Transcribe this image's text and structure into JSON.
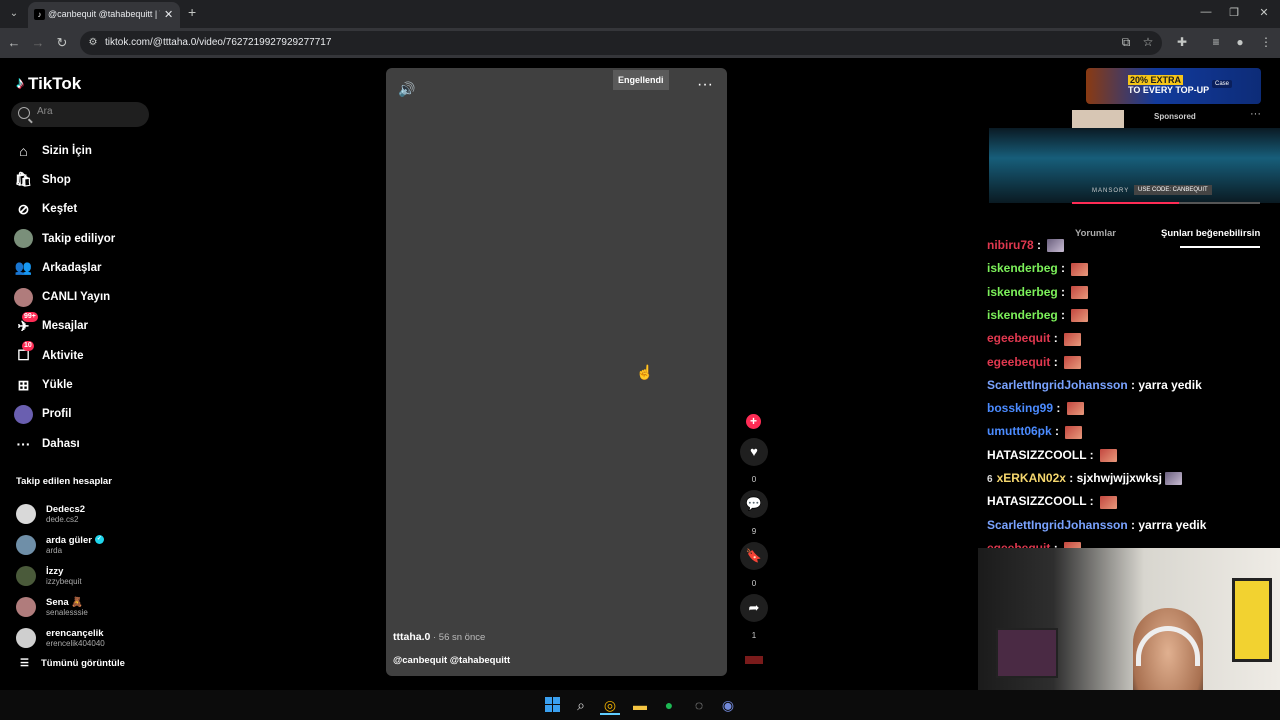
{
  "browser": {
    "tab_title": "@canbequit @tahabequitt | TikTok",
    "url": "tiktok.com/@tttaha.0/video/7627219927929277717",
    "new_tab_glyph": "+",
    "close_glyph": "✕"
  },
  "tiktok": {
    "logo_text": "TikTok",
    "search_placeholder": "Ara",
    "nav": [
      {
        "label": "Sizin İçin",
        "icon": "home-icon"
      },
      {
        "label": "Shop",
        "icon": "shop-icon"
      },
      {
        "label": "Keşfet",
        "icon": "compass-icon"
      },
      {
        "label": "Takip ediliyor",
        "icon": "following-avatar-icon"
      },
      {
        "label": "Arkadaşlar",
        "icon": "friends-icon"
      },
      {
        "label": "CANLI Yayın",
        "icon": "live-avatar-icon"
      },
      {
        "label": "Mesajlar",
        "icon": "messages-icon",
        "badge": "99+"
      },
      {
        "label": "Aktivite",
        "icon": "activity-icon",
        "badge": "10"
      },
      {
        "label": "Yükle",
        "icon": "upload-icon"
      },
      {
        "label": "Profil",
        "icon": "profile-avatar-icon"
      },
      {
        "label": "Dahası",
        "icon": "more-icon"
      }
    ],
    "following_title": "Takip edilen hesaplar",
    "following": [
      {
        "name": "Dedecs2",
        "handle": "dede.cs2",
        "avatar_color": "#d9d9d9"
      },
      {
        "name": "arda güler",
        "handle": "arda",
        "verified": true,
        "avatar_color": "#6f8fa8"
      },
      {
        "name": "İzzy",
        "handle": "izzybequit",
        "avatar_color": "#4a5a3a"
      },
      {
        "name": "Sena 🧸",
        "handle": "senalesssie",
        "avatar_color": "#b07c7c"
      },
      {
        "name": "erencançelik",
        "handle": "erencelik404040",
        "avatar_color": "#cfcfcf"
      }
    ],
    "see_all": "Tümünü görüntüle",
    "video": {
      "blocked_label": "Engellendi",
      "author": "tttaha.0",
      "time": " · 56 sn önce",
      "description": "@canbequit @tahabequitt"
    },
    "actions": [
      {
        "name": "like",
        "glyph": "♥",
        "count": "0"
      },
      {
        "name": "comment",
        "glyph": "💬",
        "count": "9"
      },
      {
        "name": "bookmark",
        "glyph": "🔖",
        "count": "0"
      },
      {
        "name": "share",
        "glyph": "➦",
        "count": "1"
      }
    ],
    "sponsored": "Sponsored",
    "ad": {
      "line1": "20% EXTRA",
      "line2": "TO EVERY TOP-UP",
      "brand": "Case",
      "video_caption": "MANSORY",
      "video_code": "USE CODE: CANBEQUIT",
      "progress": 0.57
    },
    "tabs": {
      "comments": "Yorumlar",
      "you_may_like": "Şunları beğenebilirsin"
    }
  },
  "chat": [
    {
      "user": "nibiru78",
      "color": "#e0384f",
      "text": "",
      "emote": "gray"
    },
    {
      "user": "iskenderbeg",
      "color": "#7cf05a",
      "text": "",
      "emote": "red"
    },
    {
      "user": "iskenderbeg",
      "color": "#7cf05a",
      "text": "",
      "emote": "red"
    },
    {
      "user": "iskenderbeg",
      "color": "#7cf05a",
      "text": "",
      "emote": "red"
    },
    {
      "user": "egeebequit",
      "color": "#e0384f",
      "text": "",
      "emote": "red"
    },
    {
      "user": "egeebequit",
      "color": "#e0384f",
      "text": "",
      "emote": "red"
    },
    {
      "user": "ScarlettIngridJohansson",
      "color": "#7aa3ff",
      "text": "yarra yedik",
      "emote": ""
    },
    {
      "user": "bossking99",
      "color": "#4b8bff",
      "text": "",
      "emote": "red"
    },
    {
      "user": "umuttt06pk",
      "color": "#4b8bff",
      "text": "",
      "emote": "red"
    },
    {
      "user": "HATASIZZCOOLL",
      "color": "#ffffff",
      "text": "",
      "emote": "red"
    },
    {
      "user": "xERKAN02x",
      "color": "#f5d76e",
      "text": "sjxhwjwjjxwksj",
      "emote": "gray",
      "badge": "6"
    },
    {
      "user": "HATASIZZCOOLL",
      "color": "#ffffff",
      "text": "",
      "emote": "red"
    },
    {
      "user": "ScarlettIngridJohansson",
      "color": "#7aa3ff",
      "text": "yarrra yedik",
      "emote": ""
    },
    {
      "user": "egeebequit",
      "color": "#e0384f",
      "text": "",
      "emote": "red"
    }
  ],
  "taskbar": {
    "apps": [
      "start",
      "search",
      "chrome",
      "explorer",
      "spotify",
      "app",
      "discord"
    ]
  }
}
